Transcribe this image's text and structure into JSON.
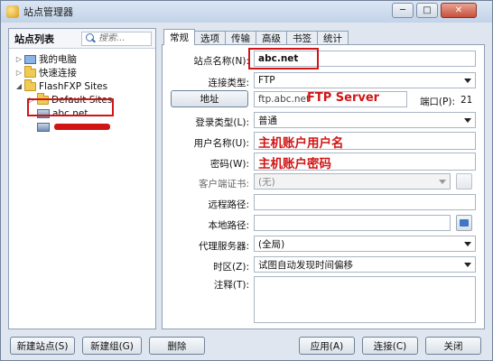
{
  "window": {
    "title": "站点管理器",
    "controls": {
      "min": "─",
      "max": "□",
      "close": "✕"
    }
  },
  "sidebar": {
    "header": "站点列表",
    "search_placeholder": "搜索...",
    "tree": {
      "my_computer": "我的电脑",
      "quick_connect": "快速连接",
      "flashfxp_sites": "FlashFXP Sites",
      "default_sites": "Default Sites",
      "abc_site": "abc.net"
    }
  },
  "tabs": [
    "常规",
    "选项",
    "传输",
    "高级",
    "书签",
    "统计"
  ],
  "form": {
    "site_name": {
      "label": "站点名称(N):",
      "value": "abc.net"
    },
    "connection_type": {
      "label": "连接类型:",
      "value": "FTP"
    },
    "address": {
      "button": "地址",
      "value": "ftp.abc.net",
      "annotation": "FTP Server",
      "port_label": "端口(P):",
      "port_value": "21"
    },
    "login_type": {
      "label": "登录类型(L):",
      "value": "普通"
    },
    "username": {
      "label": "用户名称(U):",
      "annotation": "主机账户用户名"
    },
    "password": {
      "label": "密码(W):",
      "annotation": "主机账户密码"
    },
    "client_cert": {
      "label": "客户端证书:",
      "value": "(无)"
    },
    "remote_path": {
      "label": "远程路径:",
      "value": ""
    },
    "local_path": {
      "label": "本地路径:",
      "value": ""
    },
    "proxy": {
      "label": "代理服务器:",
      "value": "(全局)"
    },
    "timezone": {
      "label": "时区(Z):",
      "value": "试图自动发现时间偏移"
    },
    "notes": {
      "label": "注释(T):",
      "value": ""
    }
  },
  "footer": {
    "new_site": "新建站点(S)",
    "new_group": "新建组(G)",
    "delete": "删除",
    "apply": "应用(A)",
    "connect": "连接(C)",
    "close": "关闭"
  }
}
